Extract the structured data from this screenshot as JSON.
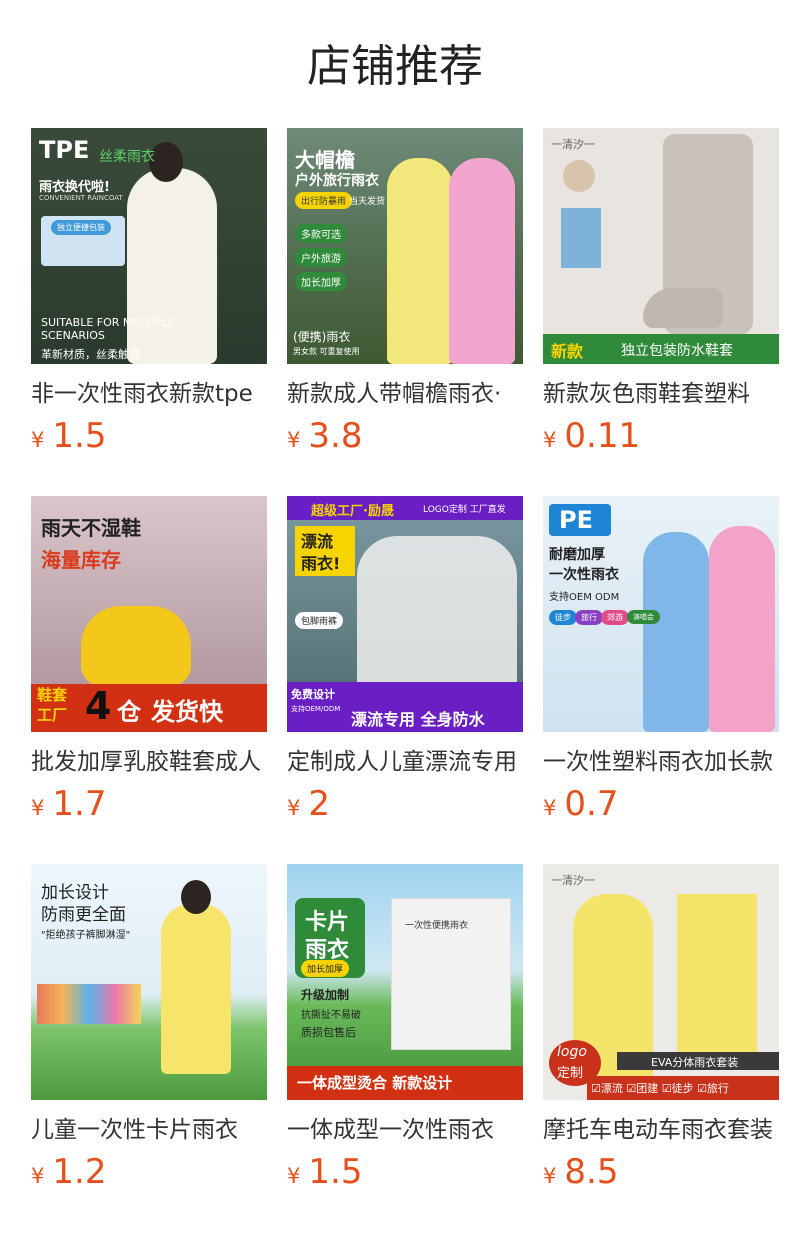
{
  "page_title": "店铺推荐",
  "currency": "¥",
  "products": [
    {
      "name": "非一次性雨衣新款tpe",
      "price": "1.5",
      "img": {
        "t1": "TPE",
        "t2": "丝柔雨衣",
        "t3": "雨衣换代啦!",
        "t4": "CONVENIENT RAINCOAT",
        "t5": "独立便捷包装",
        "t6": "SUITABLE FOR MULTIPLE",
        "t7": "SCENARIOS",
        "t8": "革新材质，丝柔触感"
      }
    },
    {
      "name": "新款成人带帽檐雨衣·",
      "price": "3.8",
      "img": {
        "t1": "大帽檐",
        "t2": "户外旅行雨衣",
        "t3": "出行防暴雨",
        "t3b": "当天发货",
        "t4": "多款可选",
        "t5": "户外旅游",
        "t6": "加长加厚",
        "t7": "(便携)雨衣",
        "t8": "男女款 可重复使用"
      }
    },
    {
      "name": "新款灰色雨鞋套塑料",
      "price": "0.11",
      "img": {
        "t1": "一清汐一",
        "t2": "新款",
        "t3": "独立包装防水鞋套"
      }
    },
    {
      "name": "批发加厚乳胶鞋套成人",
      "price": "1.7",
      "img": {
        "t1": "雨天不湿鞋",
        "t2": "海量库存",
        "t3": "鞋套",
        "t4": "工厂",
        "t5": "4",
        "t6": "仓",
        "t7": "发货快"
      }
    },
    {
      "name": "定制成人儿童漂流专用",
      "price": "2",
      "img": {
        "t1": "超级工厂·励晟",
        "t2": "LOGO定制  工厂直发",
        "t3": "漂流",
        "t4": "雨衣!",
        "t5": "包脚雨裤",
        "t6": "免费设计",
        "t7": "支持OEM/ODM",
        "t8": "漂流专用 全身防水"
      }
    },
    {
      "name": "一次性塑料雨衣加长款",
      "price": "0.7",
      "img": {
        "t1": "PE",
        "t2": "耐磨加厚",
        "t3": "一次性雨衣",
        "t4": "支持OEM ODM",
        "t5": "徒步",
        "t6": "旅行",
        "t7": "郊游",
        "t8": "演唱会"
      }
    },
    {
      "name": "儿童一次性卡片雨衣",
      "price": "1.2",
      "img": {
        "t1": "加长设计",
        "t2": "防雨更全面",
        "t3": "\"拒绝孩子裤脚淋湿\""
      }
    },
    {
      "name": "一体成型一次性雨衣",
      "price": "1.5",
      "img": {
        "t1": "卡片",
        "t2": "雨衣",
        "t3": "加长加厚",
        "t4": "升级加制",
        "t5": "抗撕扯不易破",
        "t6": "质损包售后",
        "t7": "一次性便携雨衣",
        "t8": "一体成型烫合 新款设计"
      }
    },
    {
      "name": "摩托车电动车雨衣套装",
      "price": "8.5",
      "img": {
        "t1": "一清汐一",
        "t2": "logo",
        "t3": "定制",
        "t4": "EVA分体雨衣套装",
        "t5": "☑漂流 ☑团建 ☑徒步 ☑旅行"
      }
    }
  ]
}
